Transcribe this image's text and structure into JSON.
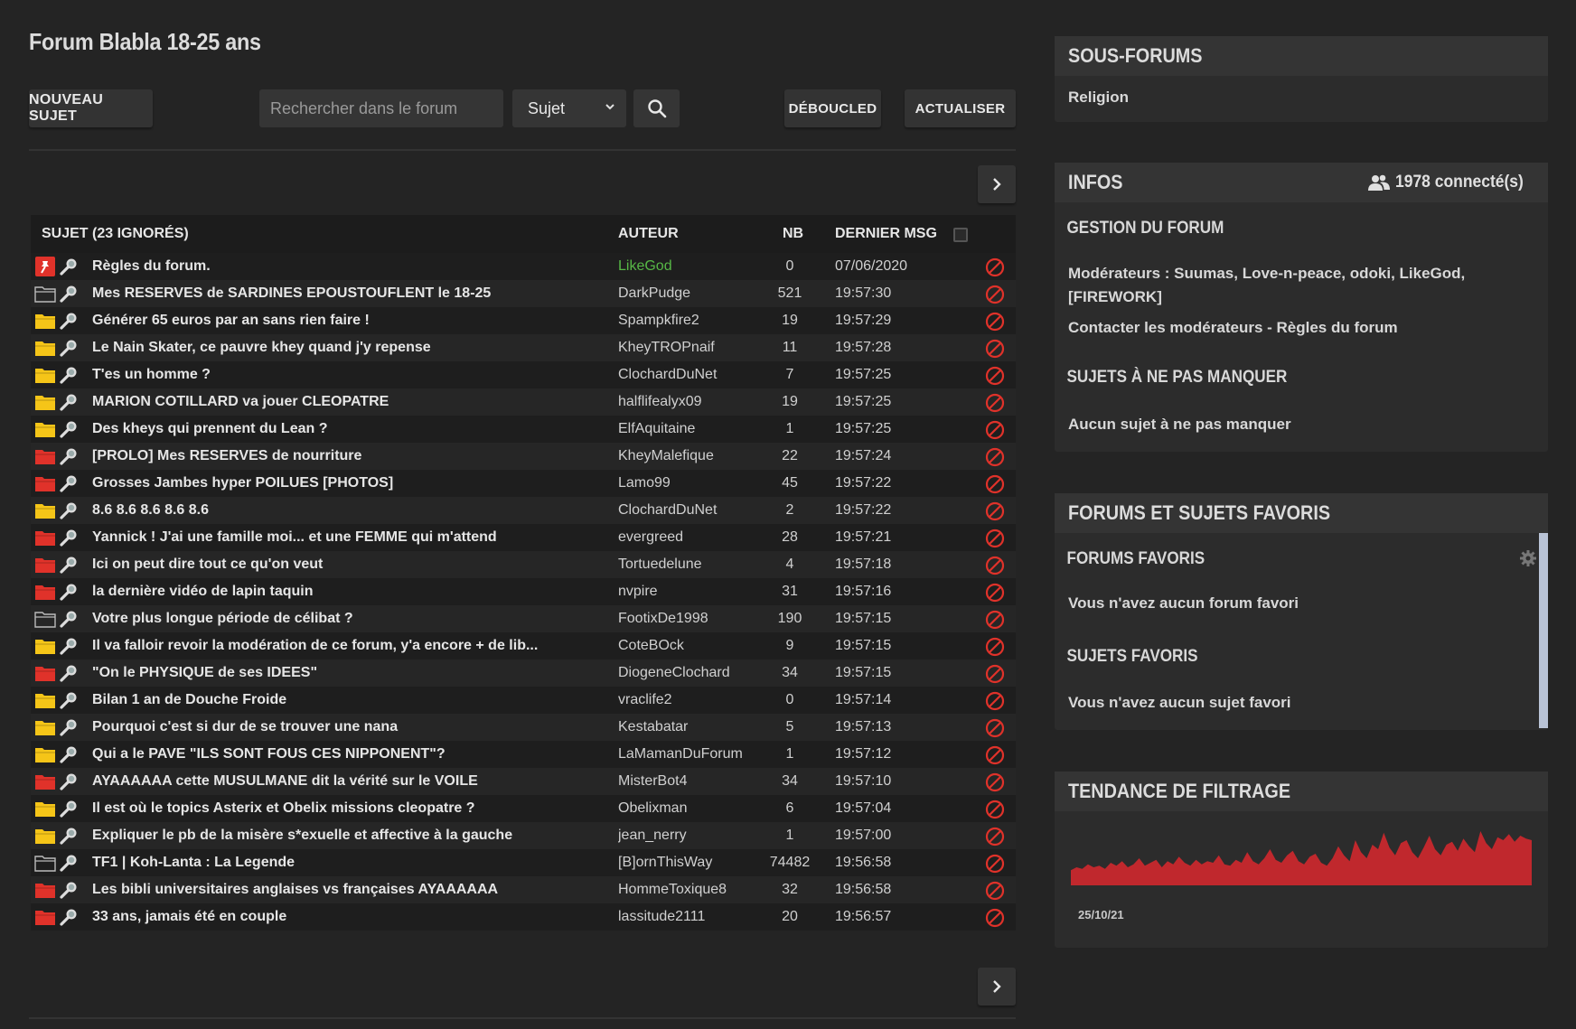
{
  "page": {
    "title": "Forum Blabla 18-25 ans"
  },
  "toolbar": {
    "new_topic": "NOUVEAU SUJET",
    "search_placeholder": "Rechercher dans le forum",
    "search_type": "Sujet",
    "deboucled": "DÉBOUCLED",
    "refresh": "ACTUALISER"
  },
  "icons": {
    "search": "search-icon",
    "next": "chevron-right-icon",
    "pin": "pin-icon",
    "folder": "folder-icon",
    "zoom": "magnifier-icon",
    "delete": "forbidden-icon",
    "users": "users-icon",
    "gear": "gear-icon"
  },
  "colors": {
    "folder_yellow": "#f5c518",
    "folder_red": "#e0322a",
    "author_green": "#57b846",
    "delete_red": "#e0322a",
    "chart_red": "#c0282d"
  },
  "topics": {
    "headers": {
      "subject": "SUJET (23 IGNORÉS)",
      "author": "AUTEUR",
      "nb": "NB",
      "last": "DERNIER MSG"
    },
    "rows": [
      {
        "icon": "pin",
        "title": "Règles du forum.",
        "author": "LikeGod",
        "nb": "0",
        "last": "07/06/2020",
        "author_color": "green"
      },
      {
        "icon": "folder-empty",
        "title": "Mes RESERVES de SARDINES EPOUSTOUFLENT le 18-25",
        "author": "DarkPudge",
        "nb": "521",
        "last": "19:57:30"
      },
      {
        "icon": "folder-yellow",
        "title": "Générer 65 euros par an sans rien faire !",
        "author": "Spampkfire2",
        "nb": "19",
        "last": "19:57:29"
      },
      {
        "icon": "folder-yellow",
        "title": "Le Nain Skater, ce pauvre khey quand j'y repense",
        "author": "KheyTROPnaif",
        "nb": "11",
        "last": "19:57:28"
      },
      {
        "icon": "folder-yellow",
        "title": "T'es un homme ?",
        "author": "ClochardDuNet",
        "nb": "7",
        "last": "19:57:25"
      },
      {
        "icon": "folder-yellow",
        "title": "MARION COTILLARD va jouer CLEOPATRE",
        "author": "halflifealyx09",
        "nb": "19",
        "last": "19:57:25"
      },
      {
        "icon": "folder-yellow",
        "title": "Des kheys qui prennent du Lean ?",
        "author": "ElfAquitaine",
        "nb": "1",
        "last": "19:57:25"
      },
      {
        "icon": "folder-red",
        "title": "[PROLO] Mes RESERVES de nourriture",
        "author": "KheyMalefique",
        "nb": "22",
        "last": "19:57:24"
      },
      {
        "icon": "folder-red",
        "title": "Grosses Jambes hyper POILUES [PHOTOS]",
        "author": "Lamo99",
        "nb": "45",
        "last": "19:57:22"
      },
      {
        "icon": "folder-yellow",
        "title": "8.6 8.6 8.6 8.6 8.6",
        "author": "ClochardDuNet",
        "nb": "2",
        "last": "19:57:22"
      },
      {
        "icon": "folder-red",
        "title": "Yannick ! J'ai une famille moi... et une FEMME qui m'attend",
        "author": "evergreed",
        "nb": "28",
        "last": "19:57:21"
      },
      {
        "icon": "folder-red",
        "title": "Ici on peut dire tout ce qu'on veut",
        "author": "Tortuedelune",
        "nb": "4",
        "last": "19:57:18"
      },
      {
        "icon": "folder-red",
        "title": "la dernière vidéo de lapin taquin",
        "author": "nvpire",
        "nb": "31",
        "last": "19:57:16"
      },
      {
        "icon": "folder-empty",
        "title": "Votre plus longue période de célibat ?",
        "author": "FootixDe1998",
        "nb": "190",
        "last": "19:57:15"
      },
      {
        "icon": "folder-yellow",
        "title": "Il va falloir revoir la modération de ce forum, y'a encore + de lib...",
        "author": "CoteBOck",
        "nb": "9",
        "last": "19:57:15"
      },
      {
        "icon": "folder-red",
        "title": "\"On le PHYSIQUE de ses IDEES\"",
        "author": "DiogeneClochard",
        "nb": "34",
        "last": "19:57:15"
      },
      {
        "icon": "folder-yellow",
        "title": "Bilan 1 an de Douche Froide",
        "author": "vraclife2",
        "nb": "0",
        "last": "19:57:14"
      },
      {
        "icon": "folder-yellow",
        "title": "Pourquoi c'est si dur de se trouver une nana",
        "author": "Kestabatar",
        "nb": "5",
        "last": "19:57:13"
      },
      {
        "icon": "folder-yellow",
        "title": "Qui a le PAVE \"ILS SONT FOUS CES NIPPONENT\"?",
        "author": "LaMamanDuForum",
        "nb": "1",
        "last": "19:57:12"
      },
      {
        "icon": "folder-red",
        "title": "AYAAAAAA cette MUSULMANE dit la vérité sur le VOILE",
        "author": "MisterBot4",
        "nb": "34",
        "last": "19:57:10"
      },
      {
        "icon": "folder-yellow",
        "title": "Il est où le topics Asterix et Obelix missions cleopatre ?",
        "author": "Obelixman",
        "nb": "6",
        "last": "19:57:04"
      },
      {
        "icon": "folder-yellow",
        "title": "Expliquer le pb de la misère s*exuelle et affective à la gauche",
        "author": "jean_nerry",
        "nb": "1",
        "last": "19:57:00"
      },
      {
        "icon": "folder-empty",
        "title": "TF1 | Koh-Lanta : La Legende",
        "author": "[B]ornThisWay",
        "nb": "74482",
        "last": "19:56:58"
      },
      {
        "icon": "folder-red",
        "title": "Les bibli universitaires anglaises vs françaises AYAAAAAA",
        "author": "HommeToxique8",
        "nb": "32",
        "last": "19:56:58"
      },
      {
        "icon": "folder-red",
        "title": "33 ans, jamais été en couple",
        "author": "lassitude2111",
        "nb": "20",
        "last": "19:56:57"
      }
    ]
  },
  "sidebar": {
    "subforums": {
      "title": "SOUS-FORUMS",
      "items": [
        "Religion"
      ]
    },
    "infos": {
      "title": "INFOS",
      "connected": "1978 connecté(s)",
      "management_title": "GESTION DU FORUM",
      "moderators_line1": "Modérateurs : Suumas, Love-n-peace, odoki, LikeGod,",
      "moderators_line2": "[FIREWORK]",
      "contact": "Contacter les modérateurs - Règles du forum",
      "must_see_title": "SUJETS À NE PAS MANQUER",
      "must_see_empty": "Aucun sujet à ne pas manquer"
    },
    "favorites": {
      "title": "FORUMS ET SUJETS FAVORIS",
      "forums_title": "FORUMS FAVORIS",
      "forums_empty": "Vous n'avez aucun forum favori",
      "topics_title": "SUJETS FAVORIS",
      "topics_empty": "Vous n'avez aucun sujet favori"
    },
    "trend": {
      "title": "TENDANCE DE FILTRAGE",
      "date_label": "25/10/21"
    }
  },
  "chart_data": {
    "type": "area",
    "title": "TENDANCE DE FILTRAGE",
    "x_start_label": "25/10/21",
    "values": [
      10,
      12,
      11,
      14,
      12,
      13,
      11,
      15,
      13,
      16,
      12,
      14,
      18,
      13,
      15,
      17,
      12,
      16,
      14,
      19,
      15,
      13,
      17,
      14,
      16,
      15,
      20,
      14,
      13,
      17,
      15,
      22,
      16,
      14,
      18,
      24,
      17,
      15,
      20,
      23,
      16,
      14,
      19,
      21,
      15,
      13,
      18,
      26,
      20,
      16,
      30,
      22,
      18,
      27,
      24,
      35,
      25,
      20,
      28,
      30,
      22,
      18,
      25,
      33,
      24,
      20,
      27,
      29,
      23,
      31,
      26,
      22,
      36,
      28,
      24,
      32,
      30,
      34,
      29,
      33,
      31,
      30
    ]
  }
}
